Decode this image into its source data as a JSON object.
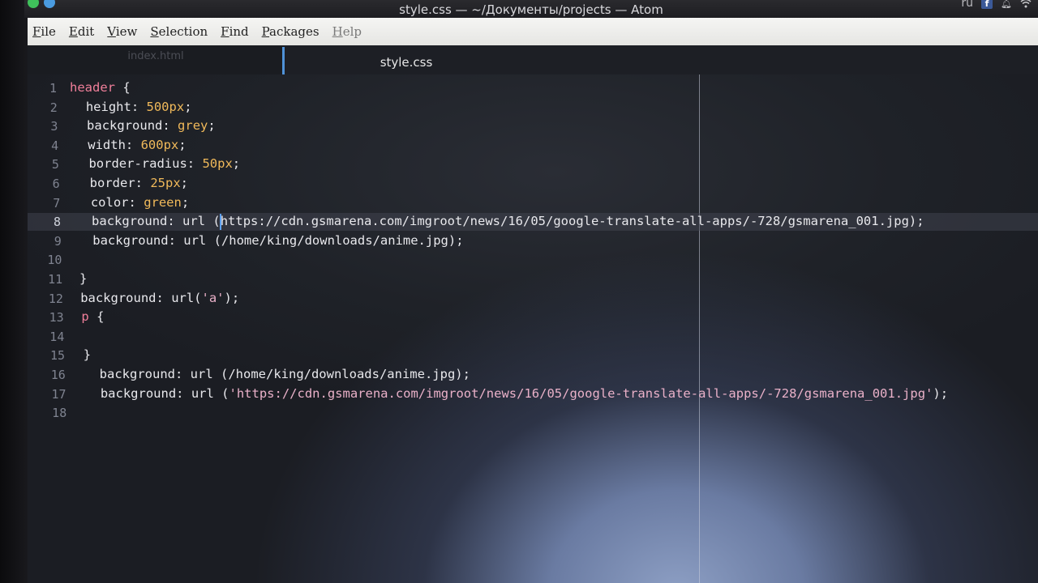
{
  "window": {
    "title": "style.css — ~/Документы/projects — Atom",
    "tray": {
      "language": "ru",
      "fb_icon": "facebook-icon",
      "bell_icon": "bell-icon",
      "wifi_icon": "wifi-icon"
    }
  },
  "menu": {
    "items": [
      {
        "mnemonic": "F",
        "rest": "ile"
      },
      {
        "mnemonic": "E",
        "rest": "dit"
      },
      {
        "mnemonic": "V",
        "rest": "iew"
      },
      {
        "mnemonic": "S",
        "rest": "election"
      },
      {
        "mnemonic": "F",
        "rest": "ind"
      },
      {
        "mnemonic": "P",
        "rest": "ackages"
      },
      {
        "mnemonic": "H",
        "rest": "elp"
      }
    ]
  },
  "tabs": {
    "inactive": "index.html",
    "active": "style.css"
  },
  "editor": {
    "cursor_line": 8,
    "lines": [
      {
        "n": "1",
        "tokens": [
          [
            "sel",
            "header"
          ],
          [
            "punc",
            " {"
          ]
        ]
      },
      {
        "n": "2",
        "tokens": [
          [
            "prop",
            "  height"
          ],
          [
            "punc",
            ": "
          ],
          [
            "val",
            "500px"
          ],
          [
            "punc",
            ";"
          ]
        ]
      },
      {
        "n": "3",
        "tokens": [
          [
            "prop",
            "  background"
          ],
          [
            "punc",
            ": "
          ],
          [
            "val",
            "grey"
          ],
          [
            "punc",
            ";"
          ]
        ]
      },
      {
        "n": "4",
        "tokens": [
          [
            "prop",
            "  width"
          ],
          [
            "punc",
            ": "
          ],
          [
            "val",
            "600px"
          ],
          [
            "punc",
            ";"
          ]
        ]
      },
      {
        "n": "5",
        "tokens": [
          [
            "prop",
            "  border-radius"
          ],
          [
            "punc",
            ": "
          ],
          [
            "val",
            "50px"
          ],
          [
            "punc",
            ";"
          ]
        ]
      },
      {
        "n": "6",
        "tokens": [
          [
            "prop",
            "  border"
          ],
          [
            "punc",
            ": "
          ],
          [
            "val",
            "25px"
          ],
          [
            "punc",
            ";"
          ]
        ]
      },
      {
        "n": "7",
        "tokens": [
          [
            "prop",
            "  color"
          ],
          [
            "punc",
            ": "
          ],
          [
            "val",
            "green"
          ],
          [
            "punc",
            ";"
          ]
        ]
      },
      {
        "n": "8",
        "tokens": [
          [
            "prop",
            "  background"
          ],
          [
            "punc",
            ": "
          ],
          [
            "urlfn",
            "url ("
          ],
          [
            "urltxt",
            "https://cdn.gsmarena.com/imgroot/news/16/05/google-translate-all-apps/-728/gsmarena_001.jpg"
          ],
          [
            "punc",
            ");"
          ]
        ]
      },
      {
        "n": "9",
        "tokens": [
          [
            "prop",
            "  background"
          ],
          [
            "punc",
            ": "
          ],
          [
            "urlfn",
            "url ("
          ],
          [
            "urltxt",
            "/home/king/downloads/anime.jpg"
          ],
          [
            "punc",
            ");"
          ]
        ]
      },
      {
        "n": "10",
        "tokens": []
      },
      {
        "n": "11",
        "tokens": [
          [
            "punc",
            "}"
          ]
        ]
      },
      {
        "n": "12",
        "tokens": [
          [
            "prop",
            "background"
          ],
          [
            "punc",
            ": "
          ],
          [
            "urlfn",
            "url("
          ],
          [
            "str",
            "'a'"
          ],
          [
            "punc",
            ");"
          ]
        ]
      },
      {
        "n": "13",
        "tokens": [
          [
            "sel",
            "p"
          ],
          [
            "punc",
            " {"
          ]
        ]
      },
      {
        "n": "14",
        "tokens": []
      },
      {
        "n": "15",
        "tokens": [
          [
            "punc",
            "}"
          ]
        ]
      },
      {
        "n": "16",
        "tokens": [
          [
            "prop",
            "  background"
          ],
          [
            "punc",
            ": "
          ],
          [
            "urlfn",
            "url ("
          ],
          [
            "urltxt",
            "/home/king/downloads/anime.jpg"
          ],
          [
            "punc",
            ");"
          ]
        ]
      },
      {
        "n": "17",
        "tokens": [
          [
            "prop",
            "  background"
          ],
          [
            "punc",
            ": "
          ],
          [
            "urlfn",
            "url ("
          ],
          [
            "str",
            "'https://cdn.gsmarena.com/imgroot/news/16/05/google-translate-all-apps/-728/gsmarena_001.jpg'"
          ],
          [
            "punc",
            ");"
          ]
        ]
      },
      {
        "n": "18",
        "tokens": []
      }
    ]
  },
  "theme": {
    "selector": "#f07f9a",
    "property": "#e8e8ec",
    "value": "#f0b95a",
    "string": "#eab1c9",
    "accent": "#4f92d8"
  }
}
